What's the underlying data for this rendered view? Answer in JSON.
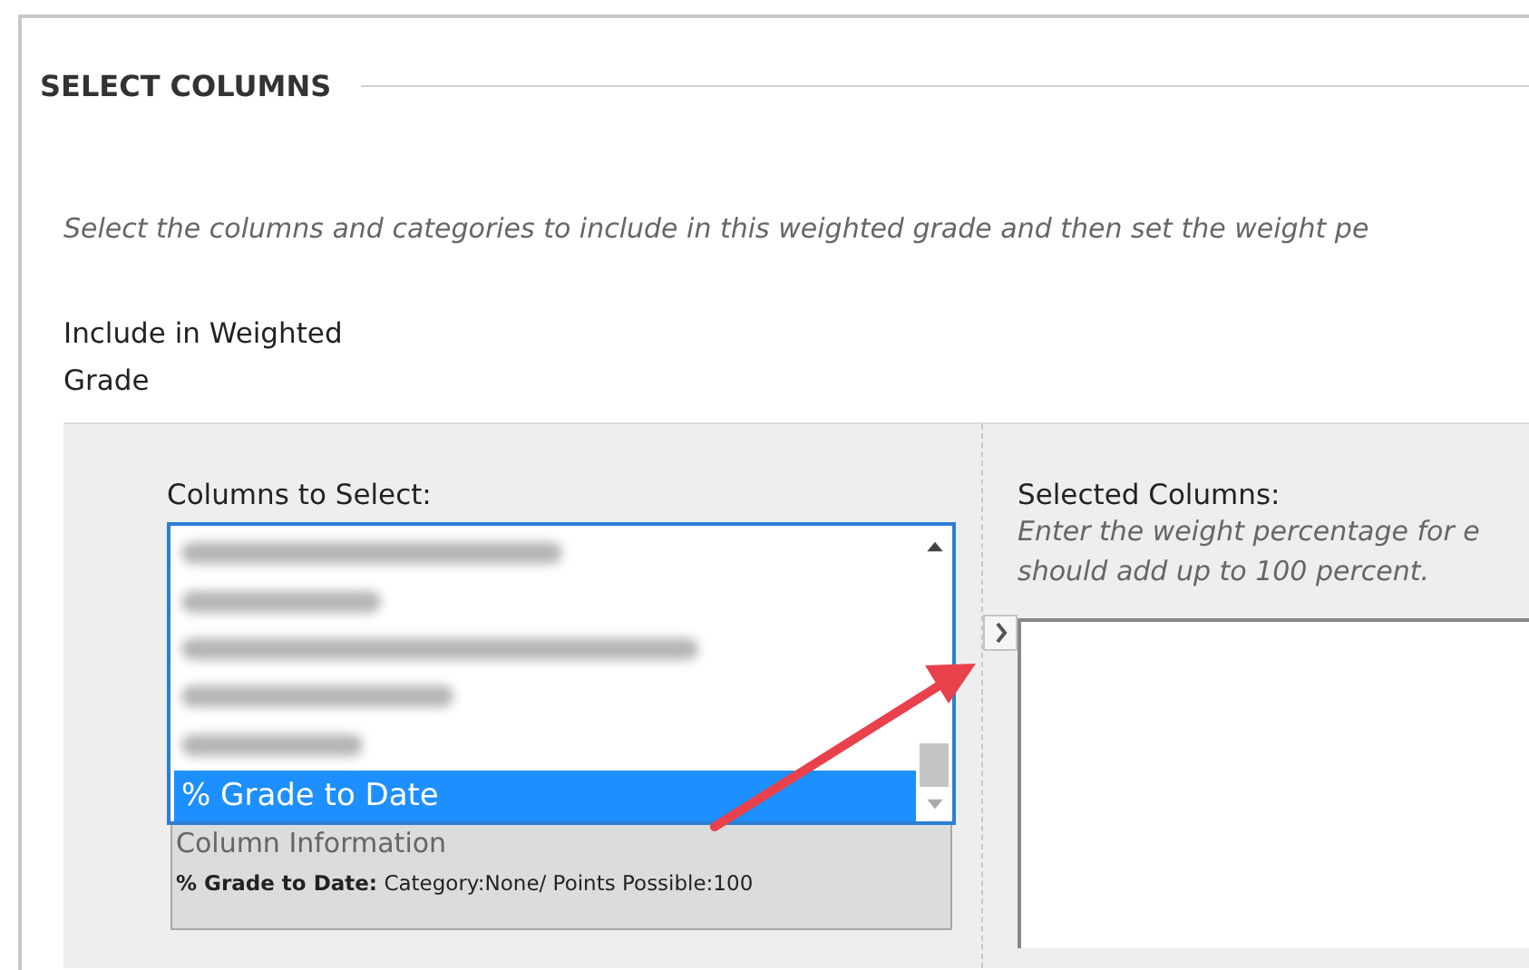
{
  "section": {
    "title": "SELECT COLUMNS",
    "instructions": "Select the columns and categories to include in this weighted grade and then set the weight pe"
  },
  "field_label": "Include in Weighted Grade",
  "columns_to_select": {
    "label": "Columns to Select:",
    "items": [
      {
        "kind": "blurred",
        "selected": false
      },
      {
        "kind": "blurred",
        "selected": false
      },
      {
        "kind": "blurred",
        "selected": false
      },
      {
        "kind": "blurred",
        "selected": false
      },
      {
        "kind": "blurred",
        "selected": false
      },
      {
        "kind": "text",
        "label": "% Grade to Date",
        "selected": true
      }
    ],
    "column_information": {
      "heading": "Column Information",
      "name": "% Grade to Date:",
      "details": "Category:None/ Points Possible:100"
    }
  },
  "selected_columns": {
    "label": "Selected Columns:",
    "hint_lines": [
      "Enter the weight percentage for e",
      "should add up to 100 percent."
    ]
  }
}
